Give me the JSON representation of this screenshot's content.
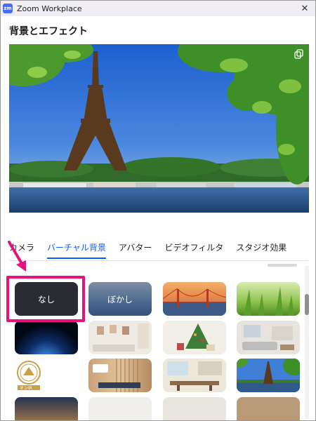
{
  "window": {
    "app_logo_text": "zm",
    "title": "Zoom Workplace",
    "close_glyph": "✕"
  },
  "heading": "背景とエフェクト",
  "tabs": [
    {
      "label": "カメラ",
      "active": false
    },
    {
      "label": "バーチャル背景",
      "active": true
    },
    {
      "label": "アバター",
      "active": false
    },
    {
      "label": "ビデオフィルタ",
      "active": false
    },
    {
      "label": "スタジオ効果",
      "active": false
    }
  ],
  "backgrounds": {
    "none_label": "なし",
    "blur_label": "ぼかし",
    "logo_caption": "オンIR"
  },
  "colors": {
    "accent": "#0b5cff",
    "highlight": "#e5127d",
    "none_tile": "#2b2b33",
    "blur_tile": "#4f6b8e"
  },
  "icons": {
    "copy": "copy-icon",
    "close": "close-icon",
    "annotation_arrow": "arrow-icon"
  }
}
